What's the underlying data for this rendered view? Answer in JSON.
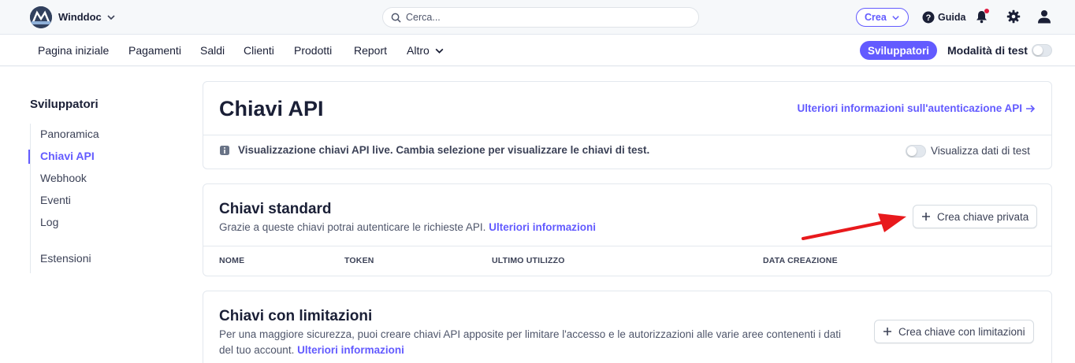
{
  "topbar": {
    "account_name": "Winddoc",
    "search_placeholder": "Cerca...",
    "create_label": "Crea",
    "help_label": "Guida"
  },
  "nav": {
    "items": [
      "Pagina iniziale",
      "Pagamenti",
      "Saldi",
      "Clienti",
      "Prodotti",
      "Report",
      "Altro"
    ],
    "developers_label": "Sviluppatori",
    "test_mode_label": "Modalità di test"
  },
  "sidebar": {
    "title": "Sviluppatori",
    "items": [
      "Panoramica",
      "Chiavi API",
      "Webhook",
      "Eventi",
      "Log",
      "Estensioni"
    ],
    "active_item": "Chiavi API"
  },
  "page": {
    "title": "Chiavi API",
    "auth_link": "Ulteriori informazioni sull'autenticazione API",
    "notice": "Visualizzazione chiavi API live. Cambia selezione per visualizzare le chiavi di test.",
    "test_data_toggle_label": "Visualizza dati di test"
  },
  "standard_keys": {
    "title": "Chiavi standard",
    "description": "Grazie a queste chiavi potrai autenticare le richieste API.",
    "link": "Ulteriori informazioni",
    "button": "Crea chiave privata",
    "columns": [
      "NOME",
      "TOKEN",
      "ULTIMO UTILIZZO",
      "DATA CREAZIONE"
    ]
  },
  "restricted_keys": {
    "title": "Chiavi con limitazioni",
    "description_line1": "Per una maggiore sicurezza, puoi creare chiavi API apposite per limitare l'accesso e le autorizzazioni alle varie aree contenenti i dati",
    "description_line2": "del tuo account.",
    "link": "Ulteriori informazioni",
    "button": "Crea chiave con limitazioni"
  },
  "colors": {
    "accent": "#635bff",
    "annotation_arrow": "#e8191c",
    "notification_dot": "#df1b41"
  }
}
